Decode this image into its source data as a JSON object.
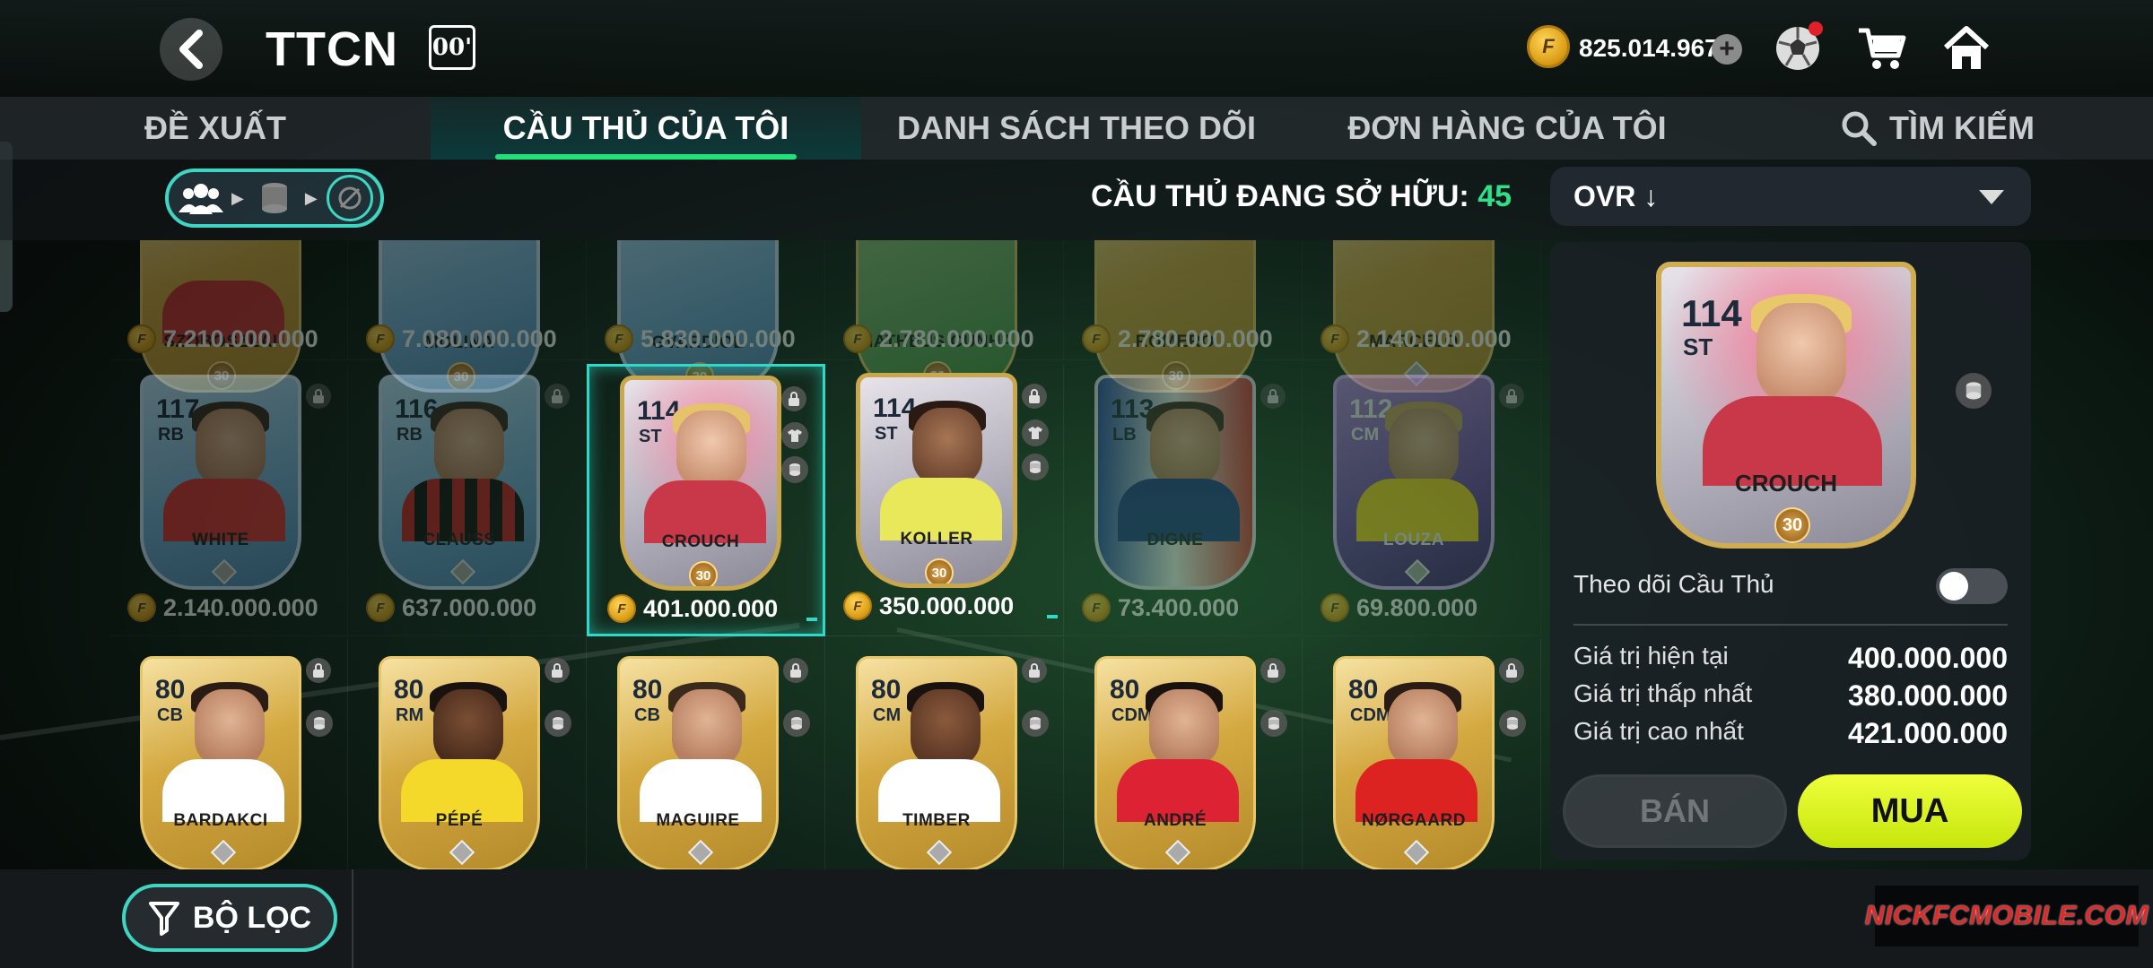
{
  "header": {
    "title": "TTCN",
    "badge": "00'",
    "balance": "825.014.967"
  },
  "tabs": [
    {
      "label": "ĐỀ XUẤT",
      "active": false
    },
    {
      "label": "CẦU THỦ CỦA TÔI",
      "active": true
    },
    {
      "label": "DANH SÁCH THEO DÕI",
      "active": false
    },
    {
      "label": "ĐƠN HÀNG CỦA TÔI",
      "active": false
    },
    {
      "label": "TÌM KIẾM",
      "active": false
    }
  ],
  "owned": {
    "label": "CẦU THỦ ĐANG SỞ HỮU:",
    "count": "45"
  },
  "sort": {
    "value": "OVR ↓"
  },
  "rows": [
    [
      {
        "name": "SZOBOSZLAI",
        "price": "7.210.000.000"
      },
      {
        "name": "MOLINA",
        "price": "7.080.000.000"
      },
      {
        "name": "GVARDIOL",
        "price": "5.830.000.000"
      },
      {
        "name": "MATHEUS CUNHA",
        "price": "2.780.000.000"
      },
      {
        "name": "ROMERO",
        "price": "2.780.000.000"
      },
      {
        "name": "MARCELO",
        "price": "2.140.000.000"
      }
    ],
    [
      {
        "ovr": "117",
        "pos": "RB",
        "name": "WHITE",
        "price": "2.140.000.000"
      },
      {
        "ovr": "116",
        "pos": "RB",
        "name": "CLAUSS",
        "price": "637.000.000"
      },
      {
        "ovr": "114",
        "pos": "ST",
        "name": "CROUCH",
        "price": "401.000.000",
        "level": "30"
      },
      {
        "ovr": "114",
        "pos": "ST",
        "name": "KOLLER",
        "price": "350.000.000",
        "level": "30"
      },
      {
        "ovr": "113",
        "pos": "LB",
        "name": "DIGNE",
        "price": "73.400.000"
      },
      {
        "ovr": "112",
        "pos": "CM",
        "name": "LOUZA",
        "price": "69.800.000"
      }
    ],
    [
      {
        "ovr": "80",
        "pos": "CB",
        "name": "BARDAKCI"
      },
      {
        "ovr": "80",
        "pos": "RM",
        "name": "PÉPÉ"
      },
      {
        "ovr": "80",
        "pos": "CB",
        "name": "MAGUIRE"
      },
      {
        "ovr": "80",
        "pos": "CM",
        "name": "TIMBER"
      },
      {
        "ovr": "80",
        "pos": "CDM",
        "name": "ANDRÉ"
      },
      {
        "ovr": "80",
        "pos": "CDM",
        "name": "NØRGAARD"
      }
    ]
  ],
  "row0_level": "30",
  "detail": {
    "ovr": "114",
    "pos": "ST",
    "name": "CROUCH",
    "level": "30",
    "follow_label": "Theo dõi Cầu Thủ",
    "current_label": "Giá trị hiện tại",
    "current_value": "400.000.000",
    "min_label": "Giá trị thấp nhất",
    "min_value": "380.000.000",
    "max_label": "Giá trị cao nhất",
    "max_value": "421.000.000",
    "sell_label": "BÁN",
    "buy_label": "MUA"
  },
  "filter_label": "BỘ LỌC",
  "watermark": "NICKFCMOBILE.COM",
  "colors": {
    "accent": "#2fd9c8",
    "owned_count": "#30e089",
    "buy": "#d8f520",
    "tab_underline": "#22e07a"
  }
}
